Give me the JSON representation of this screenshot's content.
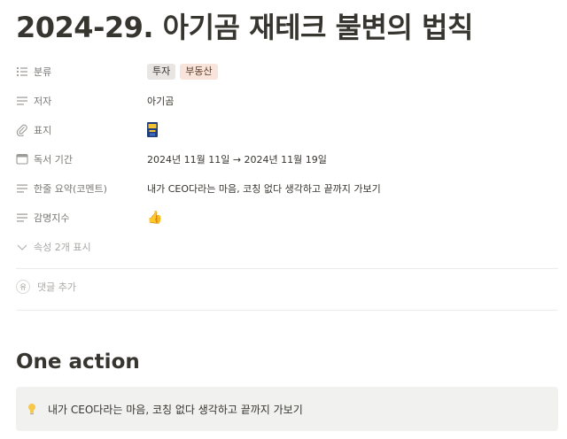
{
  "page": {
    "title": "2024-29. 아기곰 재테크 불변의 법칙"
  },
  "properties": {
    "category": {
      "icon": "list-icon",
      "label": "분류",
      "tags": [
        {
          "text": "투자",
          "bg": "#e9e5e3",
          "color": "#37352f"
        },
        {
          "text": "부동산",
          "bg": "#f9e4dc",
          "color": "#5c3b23"
        }
      ]
    },
    "author": {
      "icon": "text-icon",
      "label": "저자",
      "value": "아기곰"
    },
    "cover": {
      "icon": "paperclip-icon",
      "label": "표지"
    },
    "reading_period": {
      "icon": "calendar-icon",
      "label": "독서 기간",
      "value": "2024년 11월 11일 → 2024년 11월 19일"
    },
    "summary": {
      "icon": "text-icon",
      "label": "한줄 요약(코멘트)",
      "value": "내가 CEO다라는 마음, 코칭 없다 생각하고 끝까지 가보기"
    },
    "impression": {
      "icon": "text-icon",
      "label": "감명지수",
      "value": "👍"
    },
    "more": {
      "icon": "chevron-down-icon",
      "label": "속성 2개 표시"
    }
  },
  "comment": {
    "avatar_initial": "유",
    "label": "댓글 추가"
  },
  "section": {
    "heading": "One action"
  },
  "callout": {
    "icon": "lightbulb-icon",
    "text": "내가 CEO다라는 마음, 코칭 없다 생각하고 끝까지 가보기"
  },
  "colors": {
    "text": "#37352f",
    "muted": "#787774",
    "callout_bg": "#f1f1ef"
  }
}
